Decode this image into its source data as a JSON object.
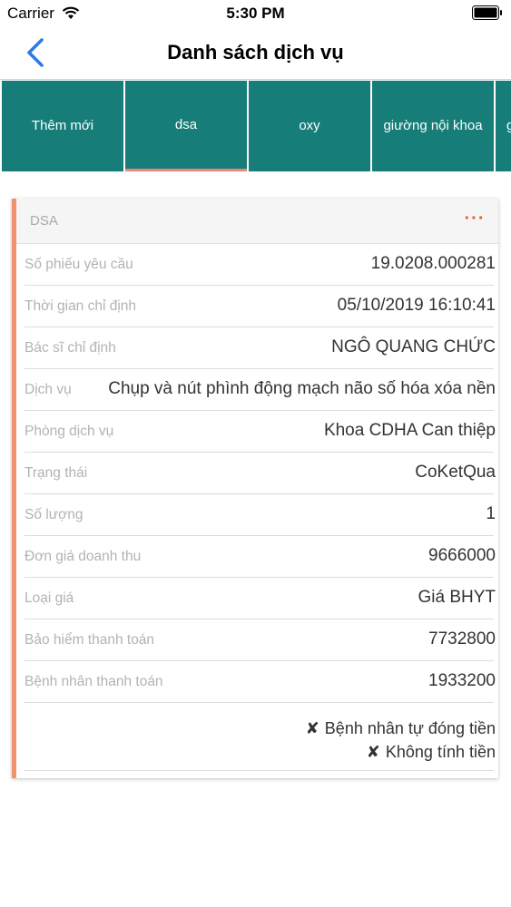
{
  "status_bar": {
    "carrier": "Carrier",
    "time": "5:30 PM"
  },
  "nav": {
    "title": "Danh sách dịch vụ",
    "back_icon": "chevron-left-icon"
  },
  "tabs": [
    {
      "label": "Thêm mới",
      "active": false
    },
    {
      "label": "dsa",
      "active": true
    },
    {
      "label": "oxy",
      "active": false
    },
    {
      "label": "giường nội khoa",
      "active": false
    },
    {
      "label": "g",
      "active": false
    }
  ],
  "card": {
    "title": "DSA",
    "more_icon": "ellipsis-icon",
    "more_label": "···",
    "rows": [
      {
        "label": "Số phiếu yêu cầu",
        "value": "19.0208.000281"
      },
      {
        "label": "Thời gian chỉ định",
        "value": "05/10/2019 16:10:41"
      },
      {
        "label": "Bác sĩ chỉ định",
        "value": "NGÔ QUANG CHỨC"
      },
      {
        "label": "Dịch vụ",
        "value": "Chụp và nút phình động mạch não số hóa xóa nền"
      },
      {
        "label": "Phòng dịch vụ",
        "value": "Khoa CDHA Can thiệp"
      },
      {
        "label": "Trạng thái",
        "value": "CoKetQua"
      },
      {
        "label": "Số lượng",
        "value": "1"
      },
      {
        "label": "Đơn giá doanh thu",
        "value": "9666000"
      },
      {
        "label": "Loại giá",
        "value": "Giá BHYT"
      },
      {
        "label": "Bảo hiểm thanh toán",
        "value": "7732800"
      },
      {
        "label": "Bệnh nhân thanh toán",
        "value": "1933200"
      }
    ],
    "flags": [
      {
        "mark": "✘",
        "label": "Bệnh nhân tự đóng tiền"
      },
      {
        "mark": "✘",
        "label": "Không tính tiền"
      }
    ]
  },
  "colors": {
    "tab_bg": "#167d78",
    "tab_active_underline": "#e8887a",
    "card_accent": "#f0936d",
    "more_icon": "#e5622e",
    "back_icon": "#2f7ae5"
  }
}
